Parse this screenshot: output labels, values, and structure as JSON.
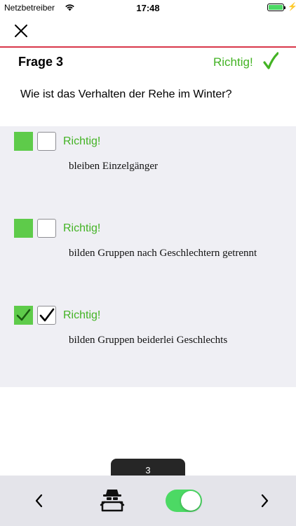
{
  "status_bar": {
    "carrier": "Netzbetreiber",
    "time": "17:48",
    "battery_level": 1.0
  },
  "nav": {
    "close_icon": "close-icon"
  },
  "question": {
    "number_label": "Frage 3",
    "result_label": "Richtig!",
    "text": "Wie ist das Verhalten der Rehe im Winter?"
  },
  "answers": [
    {
      "text": "bleiben Einzelgänger",
      "verdict": "Richtig!",
      "is_correct_option": false,
      "user_checked": false
    },
    {
      "text": "bilden Gruppen nach Geschlechtern getrennt",
      "verdict": "Richtig!",
      "is_correct_option": false,
      "user_checked": false
    },
    {
      "text": "bilden Gruppen beiderlei Geschlechts",
      "verdict": "Richtig!",
      "is_correct_option": true,
      "user_checked": true
    }
  ],
  "counter": "3",
  "toolbar": {
    "prev_icon": "chevron-left-icon",
    "examiner_icon": "examiner-icon",
    "toggle_on": true,
    "next_icon": "chevron-right-icon"
  },
  "colors": {
    "accent_green": "#43b324",
    "box_green": "#5ecb4a",
    "divider_red": "#d9374a",
    "answers_bg": "#efeff4",
    "toggle_green": "#4cd964"
  }
}
